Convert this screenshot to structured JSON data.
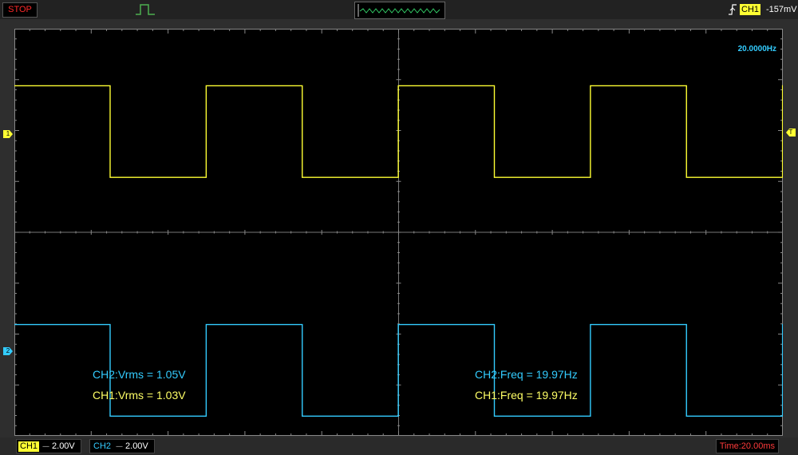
{
  "toolbar": {
    "run_state": "STOP",
    "trigger_source": "CH1",
    "trigger_level": "-157mV"
  },
  "screen": {
    "freq_readout": "20.0000Hz",
    "measurements": {
      "ch2_vrms": "CH2:Vrms = 1.05V",
      "ch1_vrms": "CH1:Vrms = 1.03V",
      "ch2_freq": "CH2:Freq = 19.97Hz",
      "ch1_freq": "CH1:Freq = 19.97Hz"
    },
    "ch1_marker": "1",
    "ch2_marker": "2",
    "trigger_marker": "T"
  },
  "status": {
    "ch1_label": "CH1",
    "ch1_coupling": "----",
    "ch1_scale": "2.00V",
    "ch2_label": "CH2",
    "ch2_coupling": "----",
    "ch2_scale": "2.00V",
    "timebase": "Time:20.00ms"
  },
  "colors": {
    "ch1": "#ffff33",
    "ch2": "#33ccff",
    "stop": "#ff2a2a"
  },
  "waveforms": {
    "ch1": {
      "high_volts": 1.9,
      "low_volts": -1.7,
      "period_ms": 50
    },
    "ch2": {
      "high_volts": 1.05,
      "low_volts": -2.55,
      "period_ms": 50
    }
  }
}
